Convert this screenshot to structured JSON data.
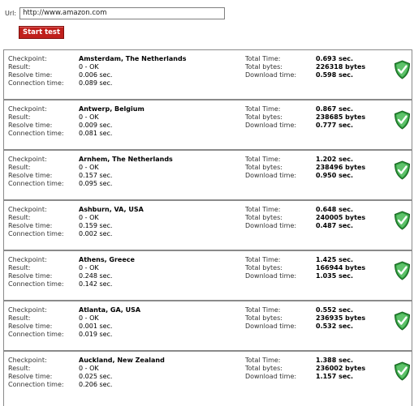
{
  "url": {
    "label": "Url:",
    "value": "http://www.amazon.com"
  },
  "start_button": "Start test",
  "labels": {
    "checkpoint": "Checkpoint:",
    "result": "Result:",
    "resolve": "Resolve time:",
    "connection": "Connection time:",
    "total_time": "Total Time:",
    "total_bytes": "Total bytes:",
    "download": "Download time:"
  },
  "rows": [
    {
      "checkpoint": "Amsterdam, The Netherlands",
      "result": "0 - OK",
      "resolve": "0.006 sec.",
      "connection": "0.089 sec.",
      "total_time": "0.693 sec.",
      "total_bytes": "226318 bytes",
      "download": "0.598 sec."
    },
    {
      "checkpoint": "Antwerp, Belgium",
      "result": "0 - OK",
      "resolve": "0.009 sec.",
      "connection": "0.081 sec.",
      "total_time": "0.867 sec.",
      "total_bytes": "238685 bytes",
      "download": "0.777 sec."
    },
    {
      "checkpoint": "Arnhem, The Netherlands",
      "result": "0 - OK",
      "resolve": "0.157 sec.",
      "connection": "0.095 sec.",
      "total_time": "1.202 sec.",
      "total_bytes": "238496 bytes",
      "download": "0.950 sec."
    },
    {
      "checkpoint": "Ashburn, VA, USA",
      "result": "0 - OK",
      "resolve": "0.159 sec.",
      "connection": "0.002 sec.",
      "total_time": "0.648 sec.",
      "total_bytes": "240005 bytes",
      "download": "0.487 sec."
    },
    {
      "checkpoint": "Athens, Greece",
      "result": "0 - OK",
      "resolve": "0.248 sec.",
      "connection": "0.142 sec.",
      "total_time": "1.425 sec.",
      "total_bytes": "166944 bytes",
      "download": "1.035 sec."
    },
    {
      "checkpoint": "Atlanta, GA, USA",
      "result": "0 - OK",
      "resolve": "0.001 sec.",
      "connection": "0.019 sec.",
      "total_time": "0.552 sec.",
      "total_bytes": "236935 bytes",
      "download": "0.532 sec."
    },
    {
      "checkpoint": "Auckland, New Zealand",
      "result": "0 - OK",
      "resolve": "0.025 sec.",
      "connection": "0.206 sec.",
      "total_time": "1.388 sec.",
      "total_bytes": "236002 bytes",
      "download": "1.157 sec."
    }
  ],
  "status_icon": "shield-check-icon",
  "colors": {
    "button": "#c0201c",
    "shield": "#2e9a3c",
    "border": "#8a8a8a"
  }
}
